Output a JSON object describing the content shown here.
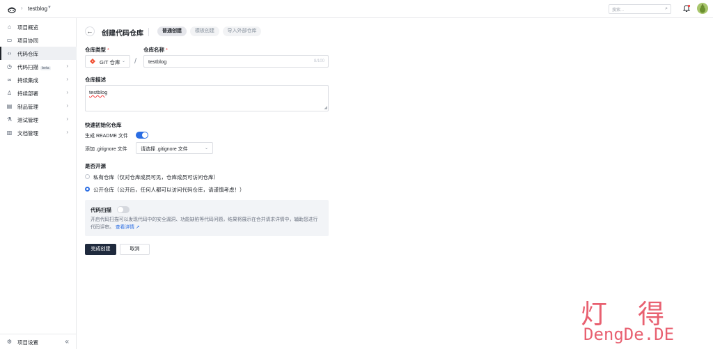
{
  "header": {
    "project_name": "testblog",
    "search_placeholder": "搜索..."
  },
  "sidebar": {
    "items": [
      {
        "label": "项目概览",
        "icon": "home-icon",
        "chevron": false,
        "active": false
      },
      {
        "label": "项目协同",
        "icon": "inbox-icon",
        "chevron": false,
        "active": false
      },
      {
        "label": "代码仓库",
        "icon": "code-icon",
        "chevron": false,
        "active": true
      },
      {
        "label": "代码扫描",
        "badge": "beta",
        "icon": "scan-icon",
        "chevron": true,
        "active": false
      },
      {
        "label": "持续集成",
        "icon": "infinity-icon",
        "chevron": true,
        "active": false
      },
      {
        "label": "持续部署",
        "icon": "rocket-icon",
        "chevron": true,
        "active": false
      },
      {
        "label": "制品管理",
        "icon": "box-icon",
        "chevron": true,
        "active": false
      },
      {
        "label": "测试管理",
        "icon": "flask-icon",
        "chevron": true,
        "active": false
      },
      {
        "label": "文档管理",
        "icon": "book-icon",
        "chevron": true,
        "active": false
      }
    ],
    "footer_label": "项目设置"
  },
  "page": {
    "title": "创建代码仓库",
    "tabs": [
      {
        "label": "普通创建",
        "active": true
      },
      {
        "label": "模板创建",
        "active": false
      },
      {
        "label": "导入外部仓库",
        "active": false
      }
    ]
  },
  "form": {
    "repo_type_label": "仓库类型",
    "repo_type_value": "GIT 仓库",
    "repo_name_label": "仓库名称",
    "repo_name_value": "testblog",
    "repo_name_counter": "8/100",
    "required_mark": "*",
    "separator": "/",
    "desc_label": "仓库描述",
    "desc_value": "testblog",
    "init_section_label": "快速初始化仓库",
    "readme_label": "生成 README 文件",
    "readme_on": true,
    "gitignore_label": "添加 .gitignore 文件",
    "gitignore_placeholder": "请选择 .gitignore 文件",
    "open_source_label": "是否开源",
    "private_option": "私有仓库（仅对仓库成员可见，仓库成员可访问仓库）",
    "public_option": "公开仓库（公开后，任何人都可以访问代码仓库，请谨慎考虑！）",
    "selected_visibility": "public"
  },
  "scan": {
    "title": "代码扫描",
    "enabled": false,
    "description": "开启代码扫描可以发现代码中的安全漏洞、功能缺陷等代码问题，结果将展示在合并请求详情中，辅助您进行代码评审。",
    "link": "查看详情"
  },
  "actions": {
    "submit": "完成创建",
    "cancel": "取消"
  },
  "watermark": {
    "chars": "灯得",
    "text": "DengDe.DE"
  },
  "colors": {
    "accent": "#2a6de3",
    "primary_button": "#1f2a3d",
    "required": "#f53f3f",
    "watermark": "#e86070"
  }
}
